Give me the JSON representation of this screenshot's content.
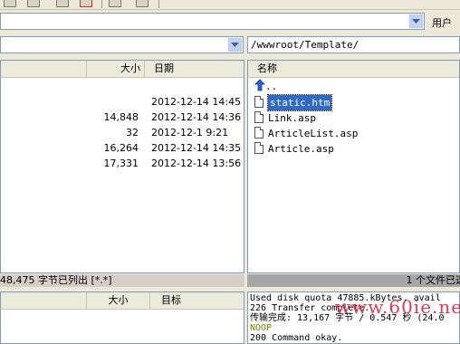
{
  "toolbar": {
    "buttons": [
      "open-icon",
      "save-icon",
      "delete-icon",
      "refresh-icon",
      "connect-icon"
    ]
  },
  "address": {
    "user_label": "用户"
  },
  "local_pane": {
    "path": "",
    "columns": {
      "size": "大小",
      "date": "日期"
    },
    "rows": [
      {
        "size": "",
        "date": "2012-12-14 14:45"
      },
      {
        "size": "14,848",
        "date": "2012-12-14 14:36"
      },
      {
        "size": "32",
        "date": "2012-12-1 9:21"
      },
      {
        "size": "16,264",
        "date": "2012-12-14 14:35"
      },
      {
        "size": "17,331",
        "date": "2012-12-14 13:56"
      }
    ],
    "status": "48,475 字节已列出 [*.*]"
  },
  "remote_pane": {
    "path": "/wwwroot/Template/",
    "columns": {
      "name": "名称"
    },
    "parent_label": "..",
    "files": [
      {
        "name": "static.htm",
        "selected": true
      },
      {
        "name": "Link.asp",
        "selected": false
      },
      {
        "name": "ArticleList.asp",
        "selected": false
      },
      {
        "name": "Article.asp",
        "selected": false
      }
    ],
    "status": "1 个文件已选"
  },
  "queue_pane": {
    "columns": {
      "size": "大小",
      "target": "目标"
    }
  },
  "log": {
    "lines": [
      "   Used disk quota 47885.kBytes, avail",
      "226 Transfer complete.",
      "传输完成: 13,167 字节 / 0.547 秒 (24.0",
      "NOOP",
      "200 Command okay."
    ],
    "colors": [
      "#000000",
      "#000000",
      "#000000",
      "#808000",
      "#000000"
    ]
  },
  "watermark": "www.60ie.net"
}
